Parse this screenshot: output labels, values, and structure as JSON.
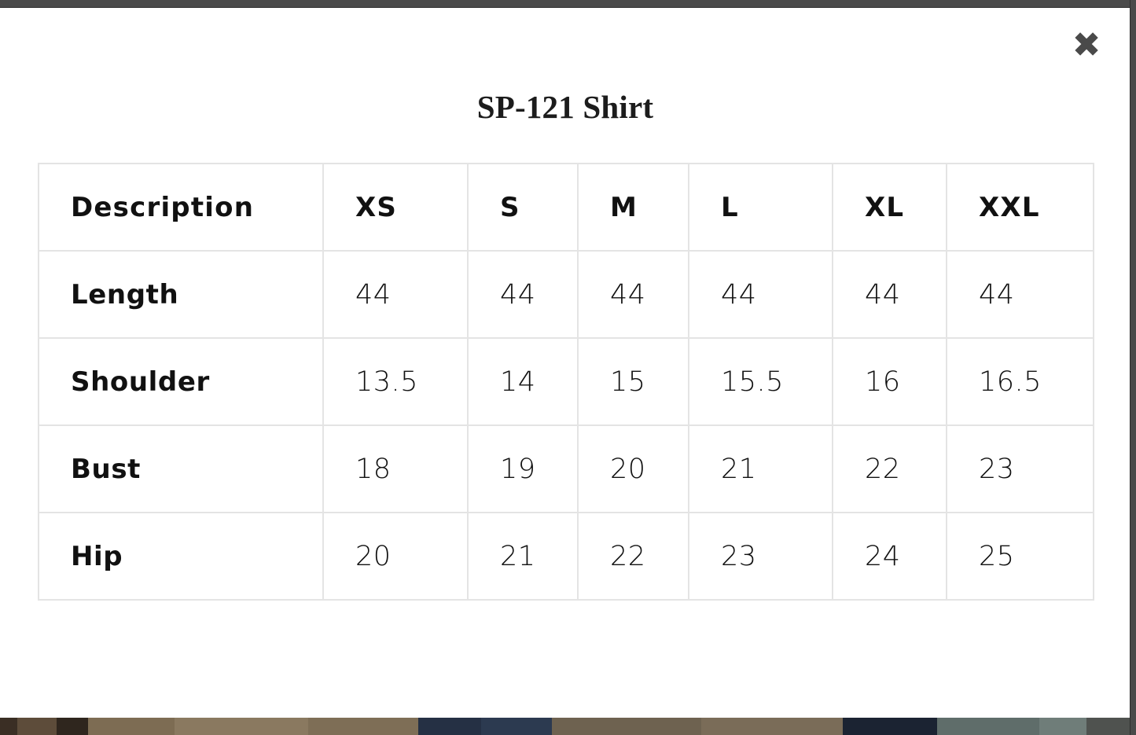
{
  "modal": {
    "title": "SP-121 Shirt",
    "close_icon": "close-icon",
    "close_label": "✖"
  },
  "size_chart": {
    "columns": [
      "Description",
      "XS",
      "S",
      "M",
      "L",
      "XL",
      "XXL"
    ],
    "rows": [
      {
        "label": "Length",
        "values": [
          "44",
          "44",
          "44",
          "44",
          "44",
          "44"
        ]
      },
      {
        "label": "Shoulder",
        "values": [
          "13.5",
          "14",
          "15",
          "15.5",
          "16",
          "16.5"
        ]
      },
      {
        "label": "Bust",
        "values": [
          "18",
          "19",
          "20",
          "21",
          "22",
          "23"
        ]
      },
      {
        "label": "Hip",
        "values": [
          "20",
          "21",
          "22",
          "23",
          "24",
          "25"
        ]
      }
    ]
  },
  "colors": {
    "text": "#111111",
    "border": "#e4e4e4",
    "close": "#4a4a4a",
    "chrome": "#4a4a4a",
    "modal_bg": "#ffffff"
  },
  "backdrop": {
    "strip_colors": [
      "#3a2e24",
      "#6b5a45",
      "#7d6c53",
      "#8a7960",
      "#7e6e56",
      "#253044",
      "#2c3a50",
      "#6e6250",
      "#7a6c58",
      "#1b2332",
      "#5f6d6a",
      "#6f7d79",
      "#4a5350",
      "#4a4a48",
      "#555553"
    ]
  }
}
